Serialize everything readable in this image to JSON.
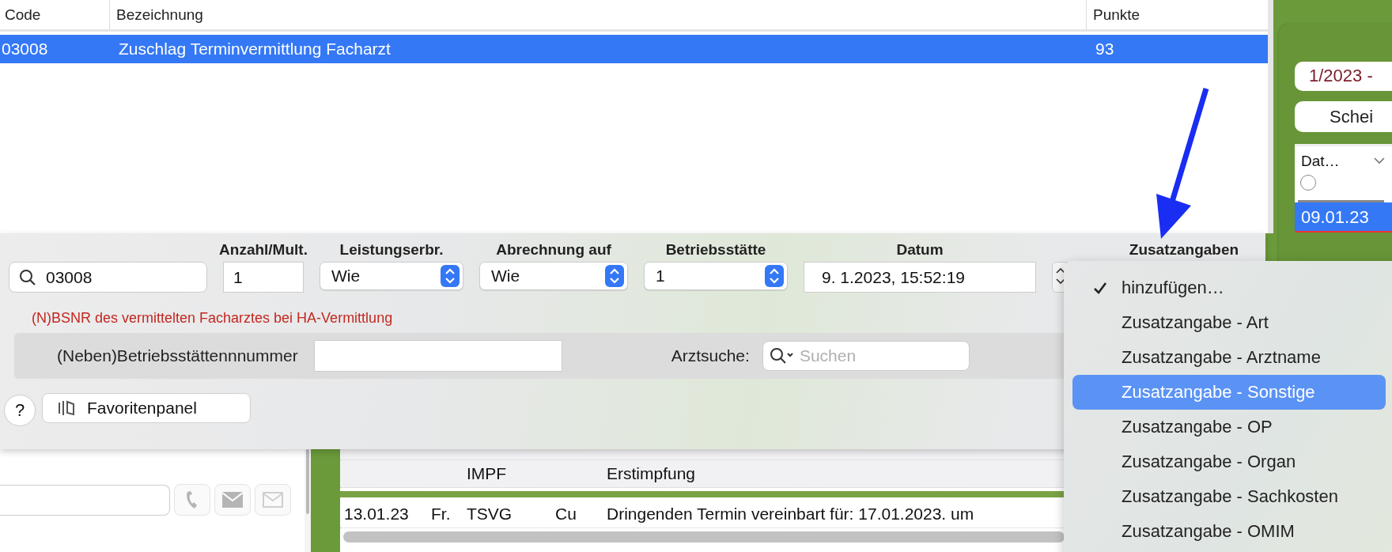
{
  "services_table": {
    "columns": [
      "Code",
      "Bezeichnung",
      "Punkte"
    ],
    "rows": [
      {
        "cells": [
          "03008",
          "Zuschlag Terminvermittlung Facharzt",
          "93"
        ],
        "selected": true
      }
    ]
  },
  "side_panel": {
    "period": "1/2023 -",
    "button": "Schei",
    "table": {
      "column": "Dat…",
      "radio_selected": false,
      "rows": [
        {
          "cells": [
            "09.01.23"
          ],
          "selected": true
        }
      ]
    }
  },
  "entry_form": {
    "search": {
      "value": "03008"
    },
    "fields": [
      {
        "kind": "text",
        "header": "Anzahl/Mult.",
        "value": "1"
      },
      {
        "kind": "select",
        "header": "Leistungserbr.",
        "value": "Wie"
      },
      {
        "kind": "select",
        "header": "Abrechnung auf",
        "value": "Wie"
      },
      {
        "kind": "select",
        "header": "Betriebsstätte",
        "value": "1"
      },
      {
        "kind": "date",
        "header": "Datum",
        "value": "9.  1.2023, 15:52:19"
      },
      {
        "kind": "menu",
        "header": "Zusatzangaben"
      }
    ],
    "hint": "(N)BSNR des vermittelten Facharztes bei HA-Vermittlung",
    "bsnr_label": "(Neben)Betriebsstättennnummer",
    "doctor_search": {
      "label": "Arztsuche:",
      "placeholder": "Suchen"
    },
    "help_button": "?",
    "favorites_button": "Favoritenpanel"
  },
  "journal": {
    "rows": [
      {
        "cells": [
          "",
          "",
          "",
          "",
          ""
        ]
      },
      {
        "cells": [
          "",
          "",
          "IMPF",
          "",
          "Erstimpfung"
        ]
      },
      {
        "cells": [
          "13.01.23",
          "Fr.",
          "TSVG",
          "Cu",
          "Dringenden Termin vereinbart für: 17.01.2023. um"
        ]
      }
    ]
  },
  "menu": {
    "items": [
      {
        "label": "hinzufügen…",
        "checked": true,
        "selected": false
      },
      {
        "label": "Zusatzangabe - Art",
        "checked": false,
        "selected": false
      },
      {
        "label": "Zusatzangabe - Arztname",
        "checked": false,
        "selected": false
      },
      {
        "label": "Zusatzangabe - Sonstige",
        "checked": false,
        "selected": true
      },
      {
        "label": "Zusatzangabe - OP",
        "checked": false,
        "selected": false
      },
      {
        "label": "Zusatzangabe - Organ",
        "checked": false,
        "selected": false
      },
      {
        "label": "Zusatzangabe - Sachkosten",
        "checked": false,
        "selected": false
      },
      {
        "label": "Zusatzangabe - OMIM",
        "checked": false,
        "selected": false
      }
    ]
  }
}
